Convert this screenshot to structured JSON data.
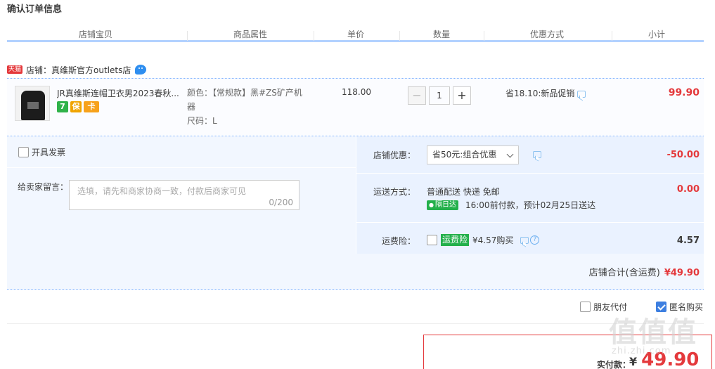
{
  "page": {
    "title": "确认订单信息"
  },
  "columns": [
    "店铺宝贝",
    "商品属性",
    "单价",
    "数量",
    "优惠方式",
    "小计"
  ],
  "shop": {
    "badge": "天猫",
    "label": "店铺：真维斯官方outlets店"
  },
  "item": {
    "title": "JR真维斯连帽卫衣男2023春秋...",
    "service_icons": [
      "7",
      "保",
      "卡"
    ],
    "attr_color": "颜色：【常规款】黑#ZS矿产机",
    "attr_color_cont": "器",
    "attr_size": "尺码：L",
    "unit_price": "118.00",
    "quantity": "1",
    "qty_minus": "−",
    "qty_plus": "+",
    "promo": "省18.10:新品促销",
    "subtotal": "99.90"
  },
  "invoice": {
    "label": "开具发票"
  },
  "message": {
    "label": "给卖家留言：",
    "placeholder": "选填，请先和商家协商一致，付款后商家可见",
    "count": "0/200"
  },
  "discount": {
    "label": "店铺优惠：",
    "selected": "省50元:组合优惠",
    "value": "-50.00"
  },
  "shipping": {
    "label": "运送方式：",
    "method": "普通配送 快递 免邮",
    "badge": "隔日达",
    "eta": "16:00前付款，预计02月25日送达",
    "value": "0.00"
  },
  "insurance": {
    "label": "运费险：",
    "badge": "运费险",
    "price": "¥4.57购买",
    "help": "?",
    "value": "4.57"
  },
  "shop_total": {
    "label": "店铺合计(含运费)",
    "value": "¥49.90"
  },
  "options": {
    "friend_pay": "朋友代付",
    "anonymous": "匿名购买"
  },
  "payment": {
    "label": "实付款：",
    "currency": "¥",
    "amount": "49.90"
  },
  "watermark": {
    "main": "值值值",
    "sub": "zhi.zhi.com"
  },
  "colors": {
    "accent": "#e4393c",
    "header_line": "#b2d1ff",
    "panel": "#f2f7ff",
    "badge_green": "#23b04b"
  }
}
